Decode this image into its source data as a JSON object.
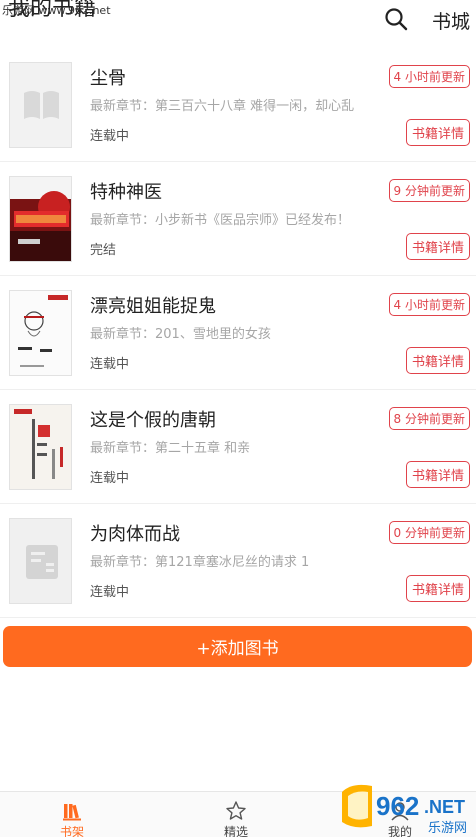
{
  "watermark": "乐游网 www.962.net",
  "header": {
    "title": "我的书籍",
    "store_label": "书城"
  },
  "books": [
    {
      "title": "尘骨",
      "latest": "最新章节：第三百六十八章 难得一闲，却心乱",
      "status": "连载中",
      "updated": "4 小时前更新",
      "detail": "书籍详情"
    },
    {
      "title": "特种神医",
      "latest": "最新章节：小步新书《医品宗师》已经发布！",
      "status": "完结",
      "updated": "9 分钟前更新",
      "detail": "书籍详情"
    },
    {
      "title": "漂亮姐姐能捉鬼",
      "latest": "最新章节：201、雪地里的女孩",
      "status": "连载中",
      "updated": "4 小时前更新",
      "detail": "书籍详情"
    },
    {
      "title": "这是个假的唐朝",
      "latest": "最新章节：第二十五章 和亲",
      "status": "连载中",
      "updated": "8 分钟前更新",
      "detail": "书籍详情"
    },
    {
      "title": "为肉体而战",
      "latest": "最新章节：第121章塞冰尼丝的请求 1",
      "status": "连载中",
      "updated": "0 分钟前更新",
      "detail": "书籍详情"
    }
  ],
  "add_button": "+添加图书",
  "tabs": [
    {
      "label": "书架",
      "icon": "bookshelf-icon"
    },
    {
      "label": "精选",
      "icon": "star-icon"
    },
    {
      "label": "我的",
      "icon": "user-icon"
    }
  ],
  "colors": {
    "accent": "#ff6a1f",
    "badge": "#e0434b"
  }
}
